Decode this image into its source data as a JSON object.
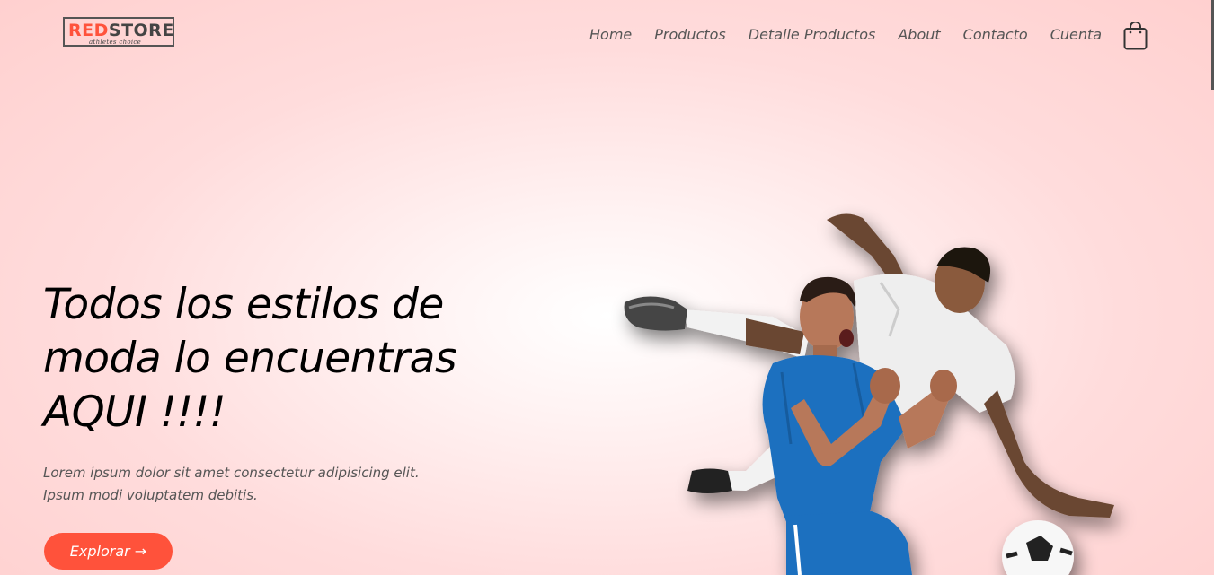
{
  "logo": {
    "part1": "RED",
    "part2": "STORE",
    "tagline": "athletes choice"
  },
  "nav": {
    "items": [
      "Home",
      "Productos",
      "Detalle Productos",
      "About",
      "Contacto",
      "Cuenta"
    ]
  },
  "icons": {
    "cart": "shopping-bag-icon"
  },
  "hero": {
    "headline_line1": "Todos los estilos de",
    "headline_line2": "moda lo encuentras",
    "headline_line3": "AQUI !!!!",
    "desc_line1": "Lorem ipsum dolor sit amet consectetur adipisicing elit.",
    "desc_line2": "Ipsum modi voluptatem debitis.",
    "button_label": "Explorar →"
  },
  "colors": {
    "accent": "#ff523b",
    "background": "#ffdcdc",
    "text": "#000000",
    "muted": "#555555"
  }
}
